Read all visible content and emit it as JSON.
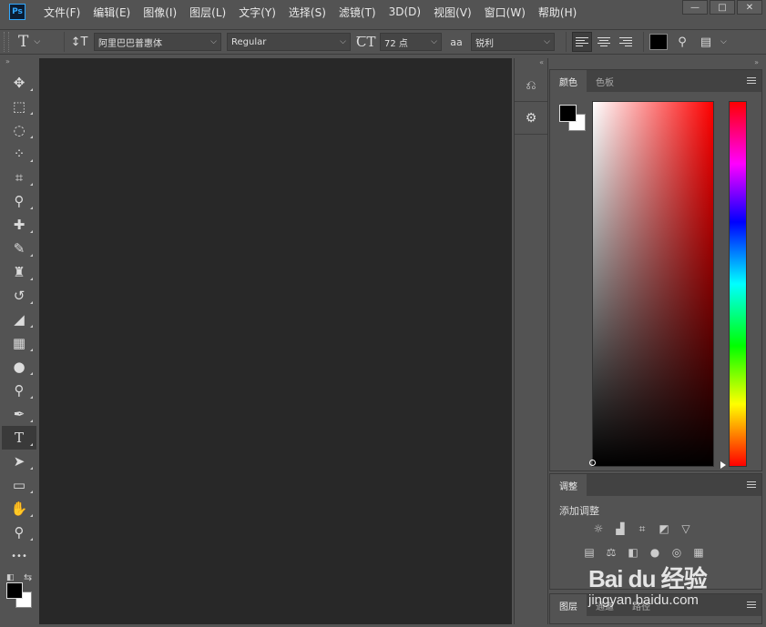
{
  "menubar": {
    "logo": "Ps",
    "items": [
      "文件(F)",
      "编辑(E)",
      "图像(I)",
      "图层(L)",
      "文字(Y)",
      "选择(S)",
      "滤镜(T)",
      "3D(D)",
      "视图(V)",
      "窗口(W)",
      "帮助(H)"
    ],
    "window_controls": [
      "—",
      "□",
      "✕"
    ]
  },
  "optionsbar": {
    "tool_glyph": "T",
    "font_family": "阿里巴巴普惠体",
    "font_style": "Regular",
    "font_size": "72 点",
    "antialias_icon": "aa",
    "antialias": "锐利",
    "text_color": "#000000"
  },
  "toolbar": {
    "collapse": "»",
    "tools": [
      {
        "name": "move-tool",
        "glyph": "✥"
      },
      {
        "name": "marquee-tool",
        "glyph": "⬚"
      },
      {
        "name": "lasso-tool",
        "glyph": "◌"
      },
      {
        "name": "quick-select-tool",
        "glyph": "⁘"
      },
      {
        "name": "crop-tool",
        "glyph": "⌗"
      },
      {
        "name": "eyedropper-tool",
        "glyph": "⚲"
      },
      {
        "name": "healing-brush-tool",
        "glyph": "✚"
      },
      {
        "name": "brush-tool",
        "glyph": "✎"
      },
      {
        "name": "stamp-tool",
        "glyph": "♜"
      },
      {
        "name": "history-brush-tool",
        "glyph": "↺"
      },
      {
        "name": "eraser-tool",
        "glyph": "◢"
      },
      {
        "name": "gradient-tool",
        "glyph": "▦"
      },
      {
        "name": "blur-tool",
        "glyph": "●"
      },
      {
        "name": "dodge-tool",
        "glyph": "⚲"
      },
      {
        "name": "pen-tool",
        "glyph": "✒"
      },
      {
        "name": "type-tool",
        "glyph": "T",
        "active": true
      },
      {
        "name": "path-select-tool",
        "glyph": "➤"
      },
      {
        "name": "shape-tool",
        "glyph": "▭"
      },
      {
        "name": "hand-tool",
        "glyph": "✋"
      },
      {
        "name": "zoom-tool",
        "glyph": "⚲"
      },
      {
        "name": "more-tools",
        "glyph": "•••"
      }
    ],
    "foreground_color": "#000000",
    "background_color": "#ffffff"
  },
  "strip": {
    "collapse": "«",
    "buttons": [
      "history-icon",
      "properties-icon"
    ]
  },
  "color_panel": {
    "collapse": "»",
    "tabs": [
      "颜色",
      "色板"
    ],
    "active_tab": 0,
    "foreground": "#000000",
    "background": "#ffffff",
    "hue": "#ff0000"
  },
  "adjust_panel": {
    "tabs": [
      "调整"
    ],
    "label": "添加调整"
  },
  "layers_panel": {
    "tabs": [
      "图层",
      "通道",
      "路径"
    ]
  },
  "watermark": {
    "logo": "Bai du 经验",
    "sub": "jingyan.baidu.com"
  }
}
